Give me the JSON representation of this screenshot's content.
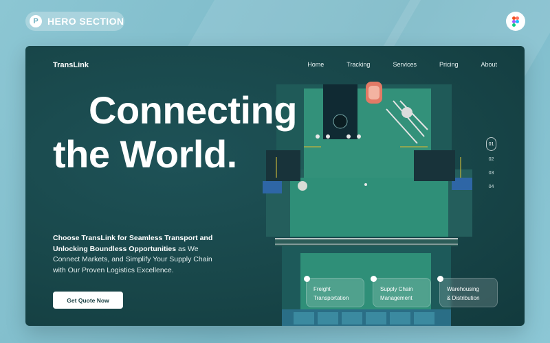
{
  "badge": {
    "logo": "P",
    "label": "HERO SECTION"
  },
  "figma_icon": "figma-icon",
  "hero": {
    "brand": "TransLink",
    "nav": [
      "Home",
      "Tracking",
      "Services",
      "Pricing",
      "About"
    ],
    "headline": {
      "line1": "Connecting",
      "line2": "the World."
    },
    "description": {
      "bold": "Choose TransLink for Seamless Transport and Unlocking Boundless Opportunities",
      "rest": " as We Connect Markets, and Simplify Your Supply Chain with Our Proven Logistics Excellence."
    },
    "cta": "Get Quote Now",
    "pager": [
      "01",
      "02",
      "03",
      "04"
    ],
    "services": [
      {
        "line1": "Freight",
        "line2": "Transportation"
      },
      {
        "line1": "Supply Chain",
        "line2": "Management"
      },
      {
        "line1": "Warehousing",
        "line2": "& Distribution"
      }
    ]
  },
  "colors": {
    "page_bg": "#8cc6d3",
    "hero_bg": "#184649",
    "deck": "#2f8f78",
    "accent_red": "#e27a66",
    "container_blue": "#2e66a6"
  }
}
